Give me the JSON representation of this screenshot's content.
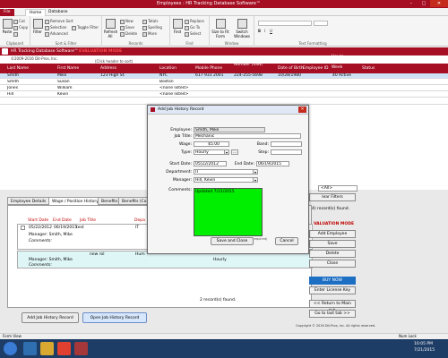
{
  "window": {
    "title": "Employees : HR Tracking Database Software™"
  },
  "menu": {
    "file": "File",
    "home": "Home",
    "database": "Database"
  },
  "ribbon": {
    "groups": {
      "clipboard": "Clipboard",
      "sort_filter": "Sort & Filter",
      "records": "Records",
      "find": "Find",
      "window": "Window",
      "text_formatting": "Text Formatting"
    },
    "items": {
      "paste": "Paste",
      "cut": "Cut",
      "copy": "Copy",
      "format_painter": "Format Painter",
      "filter": "Filter",
      "ascending": "Ascending",
      "descending": "Descending",
      "remove_sort": "Remove Sort",
      "selection": "Selection",
      "advanced": "Advanced",
      "toggle_filter": "Toggle Filter",
      "refresh_all": "Refresh All",
      "new": "New",
      "save": "Save",
      "delete": "Delete",
      "totals": "Totals",
      "spelling": "Spelling",
      "more": "More",
      "find": "Find",
      "replace": "Replace",
      "go_to": "Go To",
      "select": "Select",
      "size_to_fit_form": "Size to Fit Form",
      "switch_windows": "Switch Windows"
    }
  },
  "form_header": {
    "app_name": "HR Tracking Database Software™",
    "badge": "EVALUATION MODE",
    "copyright": "©2009-2016 Dit-Pros, Inc.",
    "hint": "(Click header to sort)"
  },
  "grid": {
    "columns": [
      "Last Name",
      "First Name",
      "Address",
      "Location",
      "Mobile Phone",
      "Social Security Number (SSN)",
      "Date of Birth",
      "Employee ID",
      "Hours Per Week",
      "Status"
    ],
    "rows": [
      {
        "last": "Smith",
        "first": "Mike",
        "address": "123 High St.",
        "location": "NYC",
        "phone": "617 931 2001",
        "ssn": "224-255-5698",
        "dob": "10/28/1980",
        "id": "",
        "hours": "40",
        "status": "Active"
      },
      {
        "last": "Smith",
        "first": "Susan",
        "address": "",
        "location": "Boston",
        "phone": "",
        "ssn": "",
        "dob": "",
        "id": "",
        "hours": "",
        "status": ""
      },
      {
        "last": "Jones",
        "first": "William",
        "address": "",
        "location": "<none listed>",
        "phone": "",
        "ssn": "",
        "dob": "",
        "id": "",
        "hours": "",
        "status": ""
      },
      {
        "last": "Hill",
        "first": "Kevin",
        "address": "",
        "location": "<none listed>",
        "phone": "",
        "ssn": "",
        "dob": "",
        "id": "",
        "hours": "",
        "status": ""
      }
    ]
  },
  "dialog": {
    "title": "Add Job History Record",
    "labels": {
      "employee": "Employee:",
      "job_title": "Job Title:",
      "wage": "Wage:",
      "band": "Band:",
      "type": "Type:",
      "step": "Step:",
      "start_date": "Start Date:",
      "end_date": "End Date:",
      "department": "Department:",
      "manager": "Manager:",
      "comments": "Comments:"
    },
    "values": {
      "employee": "Smith, Mike",
      "job_title": "Mechanic",
      "wage": "$5.00",
      "band": "",
      "type": "Hourly",
      "step": "",
      "start_date": "05/22/2012",
      "end_date": "06/19/2015",
      "department": "IT",
      "manager": "Hill, Kevin",
      "comments": "Updated 7/21/2015"
    },
    "ellipsis": "...",
    "hint": "(Field's required)",
    "save_close": "Save and Close",
    "cancel": "Cancel"
  },
  "tabs": [
    "Employee Details",
    "Wage / Position History",
    "Benefits",
    "Benefits (Co"
  ],
  "subform": {
    "headers": [
      "Start Date",
      "End Date",
      "Job Title",
      "Depa"
    ],
    "record1": {
      "start": "05/22/2012",
      "end": "06/19/2015",
      "title": "test",
      "dept": "IT"
    },
    "record1_manager": "Manager: Smith, Mike",
    "comments_label": "Comments:",
    "record2": {
      "title": "new rol",
      "dept": "Hum",
      "type": "Hourly"
    },
    "record2_manager": "Manager: Smith, Mike",
    "count": "2 record(s) found."
  },
  "bottom_buttons": {
    "add_job": "Add Job History Record",
    "open_job": "Open Job History Record"
  },
  "right_panel": {
    "combo": "<All>",
    "clear_filters": "lear Filters",
    "records_found": "4) record(s) found.",
    "mode": "VALUATION MODE",
    "add_employee": "Add Employee",
    "save": "Save",
    "delete": "Delete",
    "close": "Close",
    "buy_now": "BUY NOW",
    "enter_key": "Enter License Key",
    "return_main": "<< Return to Main tab",
    "goto_last": "Go to last tab >>",
    "copyright": "Copyright © 2016 Dit-Pros, Inc. All rights reserved."
  },
  "status": {
    "left": "Form View",
    "right": "Num Lock"
  },
  "taskbar": {
    "time": "10:05 PM",
    "date": "7/21/2015"
  },
  "colors": {
    "accent": "#a50e23",
    "comments_bg": "#00ee00",
    "buy_now": "#1d6fc4",
    "taskbar": "#1d3d66"
  }
}
